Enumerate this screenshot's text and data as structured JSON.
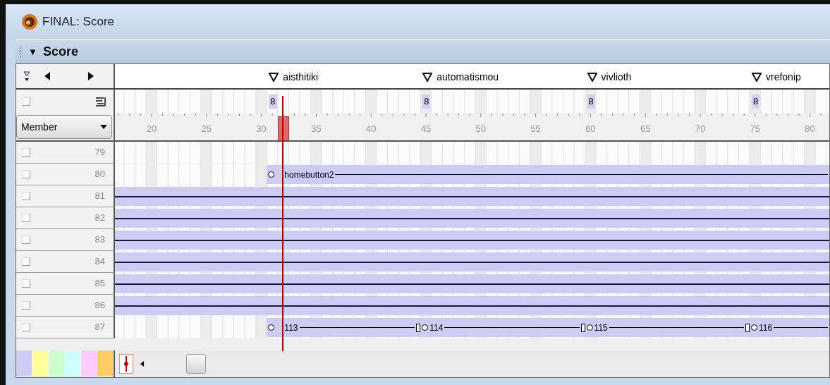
{
  "window": {
    "title": "FINAL: Score"
  },
  "panel": {
    "title": "Score",
    "toggle": "▼",
    "expanded": true
  },
  "markers": [
    {
      "label": "aisthitiki"
    },
    {
      "label": "automatismou"
    },
    {
      "label": "vivlioth"
    },
    {
      "label": "vrefonip"
    }
  ],
  "tempo_channel": [
    "8",
    "8",
    "8",
    "8"
  ],
  "member_dropdown": {
    "value": "Member"
  },
  "ruler": [
    "20",
    "25",
    "30",
    "35",
    "40",
    "45",
    "50",
    "55",
    "60",
    "65",
    "70",
    "75",
    "80"
  ],
  "rows": [
    {
      "number": "79",
      "kind": "empty"
    },
    {
      "number": "80",
      "kind": "sprite",
      "sprites": [
        {
          "label": "homebutton2"
        }
      ]
    },
    {
      "number": "81",
      "kind": "bar"
    },
    {
      "number": "82",
      "kind": "bar"
    },
    {
      "number": "83",
      "kind": "bar"
    },
    {
      "number": "84",
      "kind": "bar"
    },
    {
      "number": "85",
      "kind": "bar"
    },
    {
      "number": "86",
      "kind": "bar"
    },
    {
      "number": "87",
      "kind": "sprite",
      "sprites": [
        {
          "label": "113"
        },
        {
          "label": "114"
        },
        {
          "label": "115"
        },
        {
          "label": "116"
        }
      ]
    }
  ],
  "colors": [
    {
      "color": "#ccccf5"
    },
    {
      "color": "#ffff99"
    },
    {
      "color": "#ccffcc"
    },
    {
      "color": "#ccffff"
    },
    {
      "color": "#ffccff"
    },
    {
      "color": "#ffcc66"
    }
  ]
}
